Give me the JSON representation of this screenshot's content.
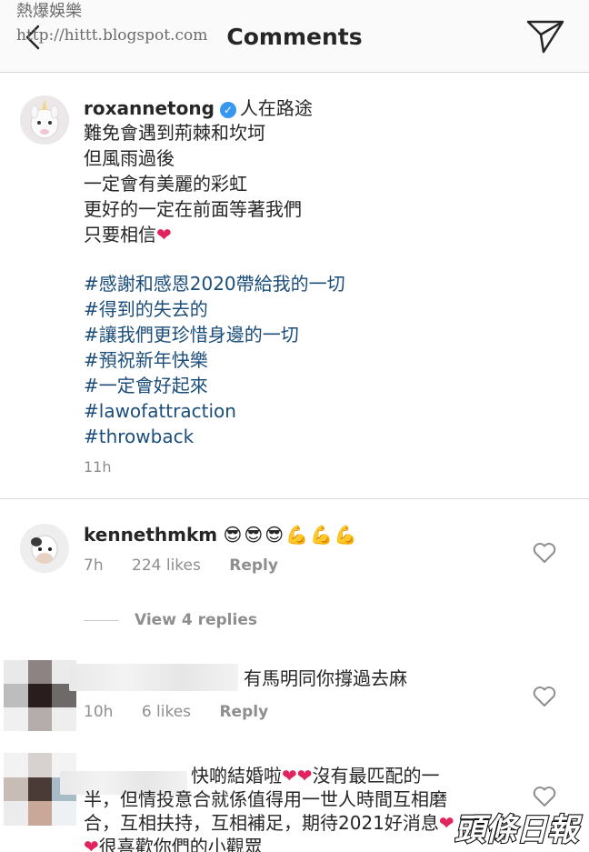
{
  "watermark": {
    "name": "熱爆娛樂",
    "url": "http://hittt.blogspot.com"
  },
  "header": {
    "title": "Comments"
  },
  "post": {
    "username": "roxannetong",
    "first_line": "人在路途",
    "lines": [
      "難免會遇到荊棘和坎坷",
      "但風雨過後",
      "一定會有美麗的彩虹",
      "更好的一定在前面等著我們"
    ],
    "last_line": "只要相信",
    "hashtags": [
      "#感謝和感恩2020帶給我的一切",
      "#得到的失去的",
      "#讓我們更珍惜身邊的一切",
      "#預祝新年快樂",
      "#一定會好起來",
      "#lawofattraction",
      "#throwback"
    ],
    "time": "11h"
  },
  "comments": [
    {
      "username": "kennethmkm",
      "text": "😎😎😎💪💪💪",
      "time": "7h",
      "likes": "224 likes",
      "reply": "Reply",
      "view_replies": "View 4 replies"
    },
    {
      "text": "有馬明同你撐過去麻",
      "time": "10h",
      "likes": "6 likes",
      "reply": "Reply"
    },
    {
      "text_1": "快啲結婚啦",
      "text_2": "沒有最匹配的一",
      "text_3": "半，但情投意合就係值得用一世人時間互相磨",
      "text_4": "合，互相扶持，互相補足，期待2021好消息",
      "text_5": "很喜歡你們的小觀眾"
    }
  ],
  "logo_text": "頭條日報",
  "icons": {
    "back": "chevron-left-icon",
    "send": "paper-plane-icon",
    "like": "heart-outline-icon",
    "verified": "verified-badge-icon"
  },
  "colors": {
    "hashtag": "#1b4d7a",
    "verified": "#3897f0",
    "heart": "#e0245e",
    "meta": "#8e8e8e"
  }
}
